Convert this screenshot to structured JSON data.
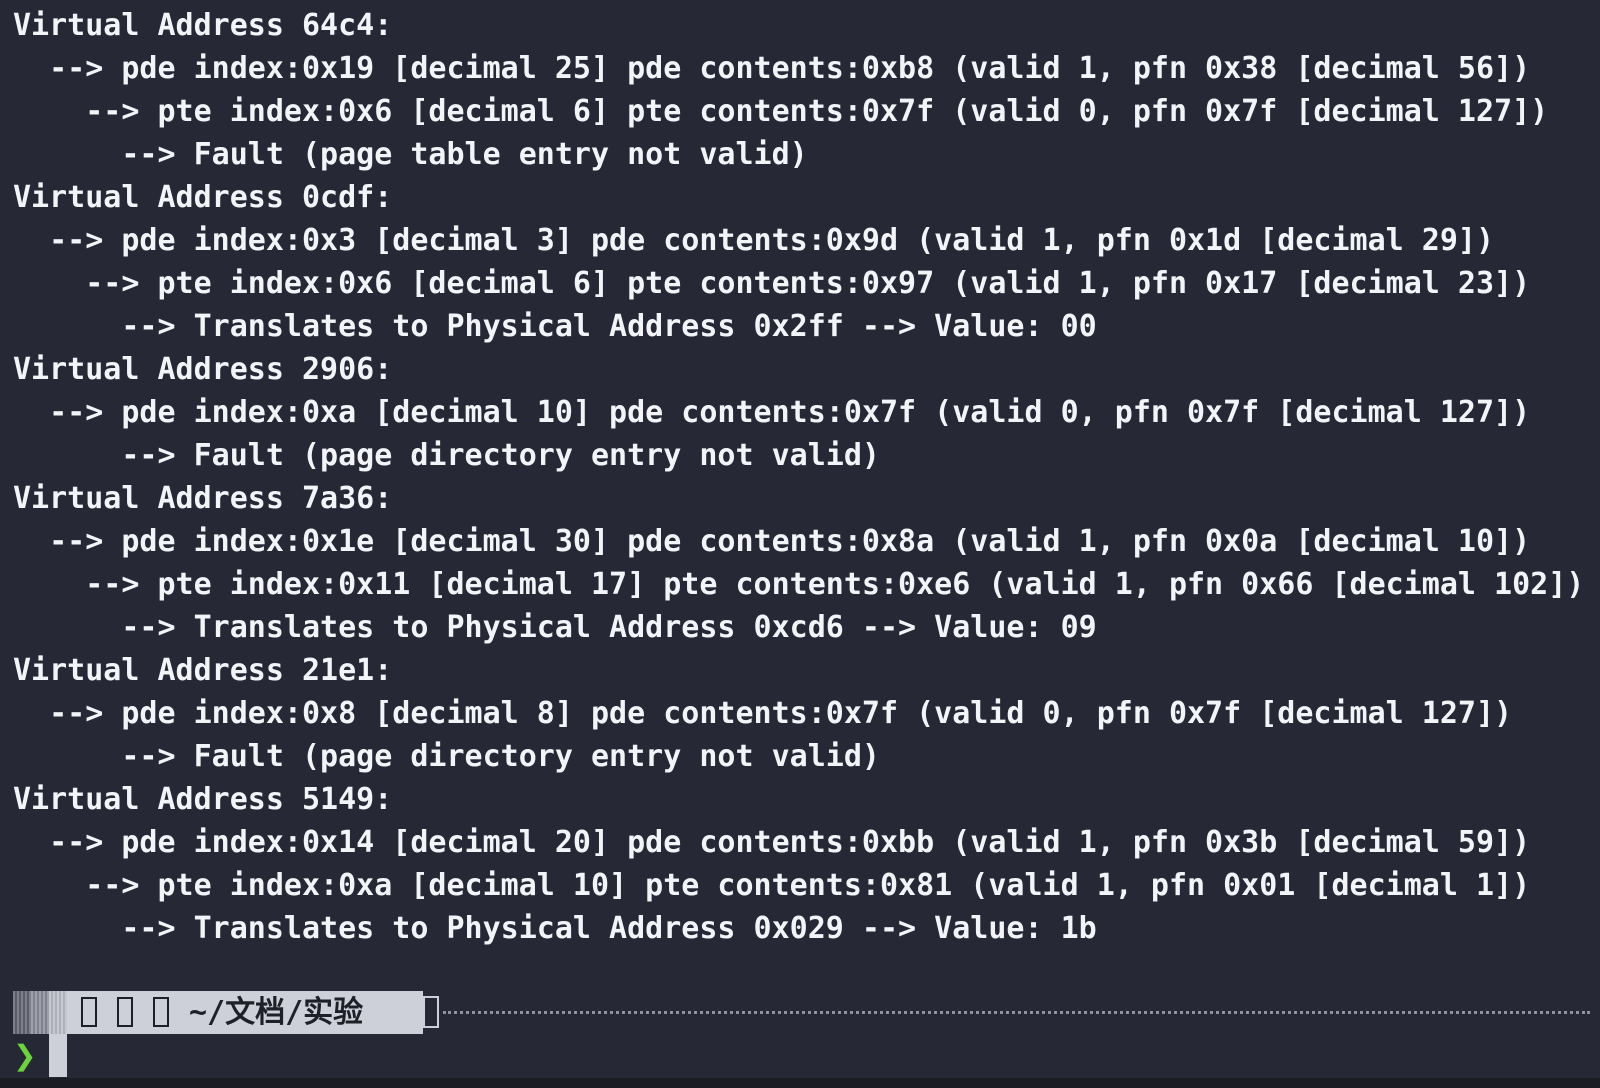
{
  "terminal": {
    "lines": [
      "Virtual Address 64c4:",
      "  --> pde index:0x19 [decimal 25] pde contents:0xb8 (valid 1, pfn 0x38 [decimal 56])",
      "    --> pte index:0x6 [decimal 6] pte contents:0x7f (valid 0, pfn 0x7f [decimal 127])",
      "      --> Fault (page table entry not valid)",
      "Virtual Address 0cdf:",
      "  --> pde index:0x3 [decimal 3] pde contents:0x9d (valid 1, pfn 0x1d [decimal 29])",
      "    --> pte index:0x6 [decimal 6] pte contents:0x97 (valid 1, pfn 0x17 [decimal 23])",
      "      --> Translates to Physical Address 0x2ff --> Value: 00",
      "Virtual Address 2906:",
      "  --> pde index:0xa [decimal 10] pde contents:0x7f (valid 0, pfn 0x7f [decimal 127])",
      "      --> Fault (page directory entry not valid)",
      "Virtual Address 7a36:",
      "  --> pde index:0x1e [decimal 30] pde contents:0x8a (valid 1, pfn 0x0a [decimal 10])",
      "    --> pte index:0x11 [decimal 17] pte contents:0xe6 (valid 1, pfn 0x66 [decimal 102])",
      "      --> Translates to Physical Address 0xcd6 --> Value: 09",
      "Virtual Address 21e1:",
      "  --> pde index:0x8 [decimal 8] pde contents:0x7f (valid 0, pfn 0x7f [decimal 127])",
      "      --> Fault (page directory entry not valid)",
      "Virtual Address 5149:",
      "  --> pde index:0x14 [decimal 20] pde contents:0xbb (valid 1, pfn 0x3b [decimal 59])",
      "    --> pte index:0xa [decimal 10] pte contents:0x81 (valid 1, pfn 0x01 [decimal 1])",
      "      --> Translates to Physical Address 0x029 --> Value: 1b"
    ]
  },
  "prompt": {
    "path": "~/文档/实验",
    "chevron": "❯",
    "input": "",
    "icons": [
      "missing-glyph-icon",
      "missing-glyph-icon",
      "missing-glyph-icon",
      "missing-glyph-icon"
    ]
  },
  "colors": {
    "background": "#262836",
    "foreground": "#f3f4f8",
    "prompt_segment": "#cdd0d8",
    "chevron": "#6bd43a"
  }
}
